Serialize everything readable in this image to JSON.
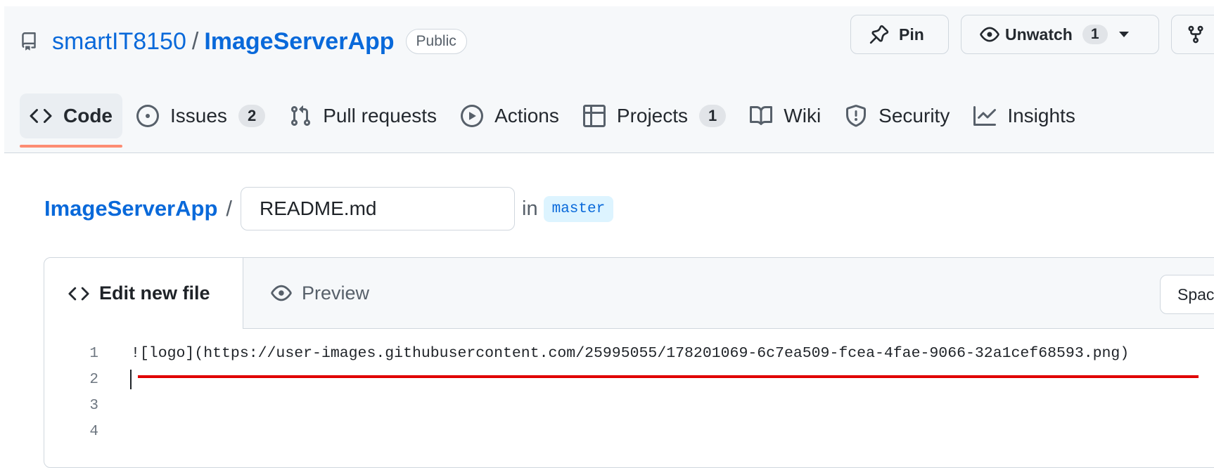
{
  "repo": {
    "owner": "smartIT8150",
    "separator": "/",
    "name": "ImageServerApp",
    "visibility": "Public"
  },
  "actions": {
    "pin_label": "Pin",
    "watch_label": "Unwatch",
    "watch_count": "1"
  },
  "tabs": [
    {
      "label": "Code",
      "icon": "code-icon",
      "count": null,
      "active": true
    },
    {
      "label": "Issues",
      "icon": "issue-opened-icon",
      "count": "2"
    },
    {
      "label": "Pull requests",
      "icon": "git-pull-request-icon",
      "count": null
    },
    {
      "label": "Actions",
      "icon": "play-icon",
      "count": null
    },
    {
      "label": "Projects",
      "icon": "table-icon",
      "count": "1"
    },
    {
      "label": "Wiki",
      "icon": "book-icon",
      "count": null
    },
    {
      "label": "Security",
      "icon": "shield-icon",
      "count": null
    },
    {
      "label": "Insights",
      "icon": "graph-icon",
      "count": null
    }
  ],
  "breadcrumb": {
    "repo": "ImageServerApp",
    "separator": "/",
    "filename": "README.md",
    "in_text": "in",
    "branch": "master"
  },
  "editor": {
    "edit_tab": "Edit new file",
    "preview_tab": "Preview",
    "indent_select": "Spac",
    "lines": [
      {
        "number": "1",
        "text": "![logo](https://user-images.githubusercontent.com/25995055/178201069-6c7ea509-fcea-4fae-9066-32a1cef68593.png)"
      },
      {
        "number": "2",
        "text": ""
      },
      {
        "number": "3",
        "text": ""
      },
      {
        "number": "4",
        "text": ""
      }
    ]
  },
  "colors": {
    "link": "#0969da",
    "active_tab_underline": "#fd8c73",
    "highlight_underline": "#e00000"
  }
}
